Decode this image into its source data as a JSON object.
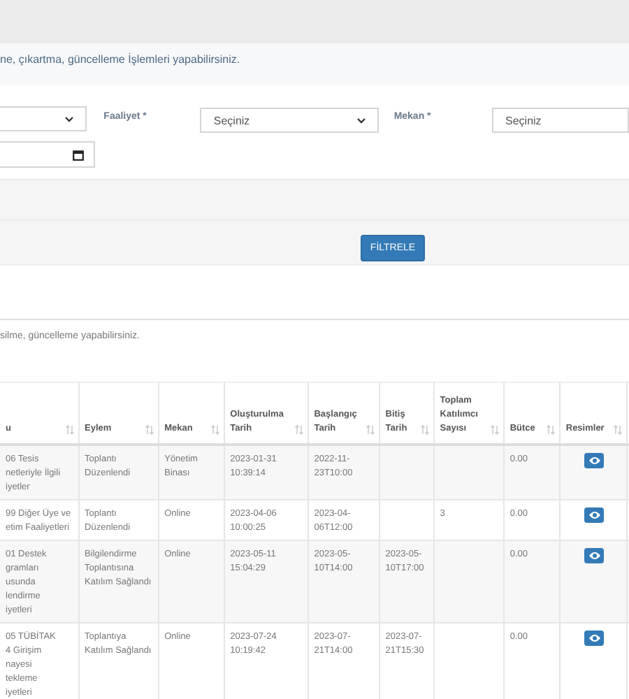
{
  "info_text": "ne, çıkartma, güncelleme İşlemleri yapabilirsiniz.",
  "filters": {
    "faaliyet": {
      "label": "Faaliyet *",
      "value": "Seçiniz"
    },
    "mekan": {
      "label": "Mekan *",
      "value": "Seçiniz"
    }
  },
  "filter_button": "FİLTRELE",
  "table_hint": "silme, güncelleme yapabilirsiniz.",
  "table": {
    "columns": [
      "u",
      "Eylem",
      "Mekan",
      "Oluşturulma Tarih",
      "Başlangıç Tarih",
      "Bitiş Tarih",
      "Toplam Katılımcı Sayısı",
      "Bütce",
      "Resimler"
    ],
    "rows": [
      {
        "cells": [
          "06 Tesis\nnetleriyle İlgili\niyetler",
          "Toplantı Düzenlendi",
          "Yönetim Binası",
          "2023-01-31 10:39:14",
          "2022-11-23T10:00",
          "",
          "",
          "0.00"
        ]
      },
      {
        "cells": [
          "99 Diğer Üye ve\netim Faaliyetleri",
          "Toplantı Düzenlendi",
          "Online",
          "2023-04-06 10:00:25",
          "2023-04-06T12:00",
          "",
          "3",
          "0.00"
        ]
      },
      {
        "cells": [
          "01 Destek\ngramları\nusunda\nlendirme\niyetleri",
          "Bilgilendirme Toplantısına Katılım Sağlandı",
          "Online",
          "2023-05-11 15:04:29",
          "2023-05-10T14:00",
          "2023-05-10T17:00",
          "",
          "0.00"
        ]
      },
      {
        "cells": [
          "05 TÜBİTAK\n4 Girişim\nnayesi\ntekleme\niyetleri",
          "Toplantıya Katılım Sağlandı",
          "Online",
          "2023-07-24 10:19:42",
          "2023-07-21T14:00",
          "2023-07-21T15:30",
          "",
          "0.00"
        ]
      }
    ]
  }
}
